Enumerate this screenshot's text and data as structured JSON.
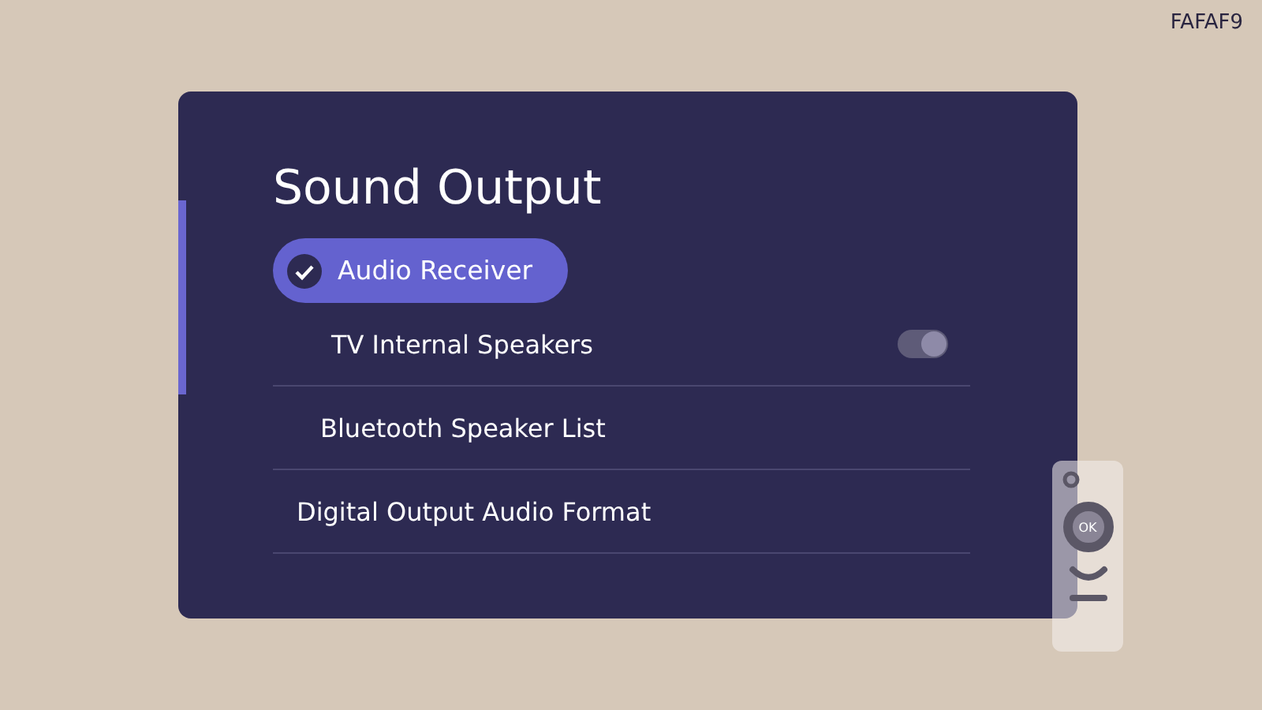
{
  "corner_label": "FAFAF9",
  "panel": {
    "title": "Sound Output",
    "options": [
      {
        "label": "Audio Receiver",
        "selected": true
      }
    ],
    "items": [
      {
        "kind": "toggle",
        "label": "TV Internal Speakers",
        "on": true,
        "disabled": true
      },
      {
        "kind": "link",
        "label": "Bluetooth Speaker List"
      },
      {
        "kind": "link",
        "label": "Digital Output Audio Format"
      }
    ]
  },
  "remote": {
    "ok_label": "OK"
  }
}
